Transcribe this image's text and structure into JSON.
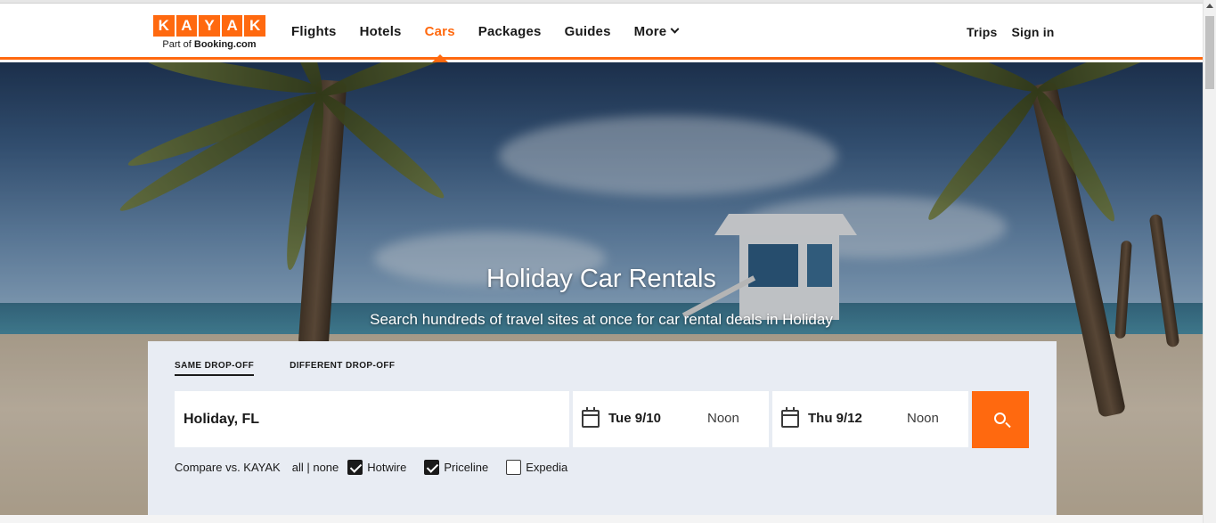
{
  "brand": {
    "letters": [
      "K",
      "A",
      "Y",
      "A",
      "K"
    ],
    "sub_prefix": "Part of",
    "sub_brand": "Booking.com",
    "color": "#ff690f"
  },
  "nav": {
    "items": [
      "Flights",
      "Hotels",
      "Cars",
      "Packages",
      "Guides",
      "More"
    ],
    "active": "Cars",
    "right": [
      "Trips",
      "Sign in"
    ]
  },
  "hero": {
    "title": "Holiday Car Rentals",
    "subtitle": "Search hundreds of travel sites at once for car rental deals in Holiday"
  },
  "search": {
    "tabs": [
      "SAME DROP-OFF",
      "DIFFERENT DROP-OFF"
    ],
    "active_tab": "SAME DROP-OFF",
    "location": "Holiday, FL",
    "pickup": {
      "date": "Tue 9/10",
      "time": "Noon"
    },
    "dropoff": {
      "date": "Thu 9/12",
      "time": "Noon"
    },
    "button_icon": "search-icon"
  },
  "compare": {
    "label": "Compare vs. KAYAK",
    "all_none": "all | none",
    "options": [
      {
        "label": "Hotwire",
        "checked": true
      },
      {
        "label": "Priceline",
        "checked": true
      },
      {
        "label": "Expedia",
        "checked": false
      }
    ]
  }
}
